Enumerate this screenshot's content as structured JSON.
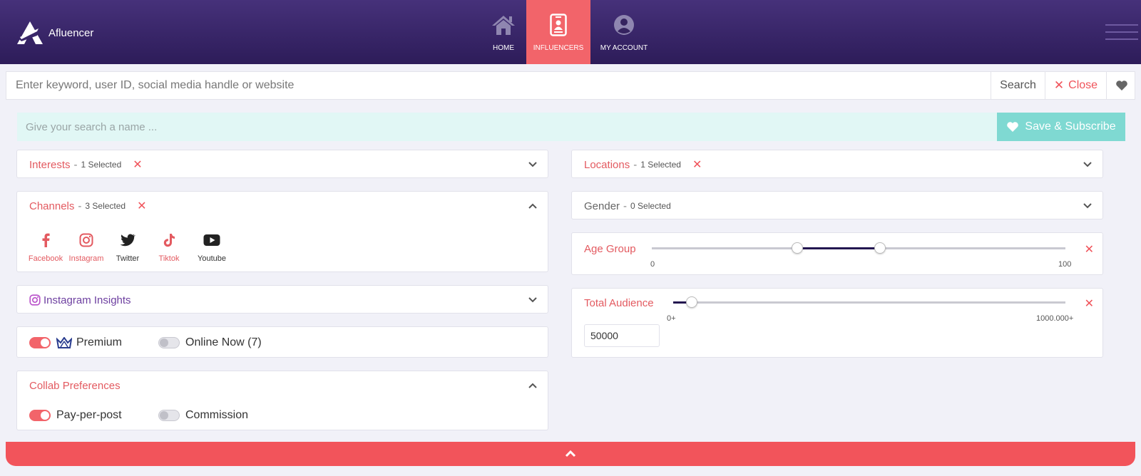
{
  "app": {
    "name": "Afluencer"
  },
  "nav": {
    "home": "HOME",
    "influencers": "INFLUENCERS",
    "account": "MY ACCOUNT"
  },
  "search": {
    "placeholder": "Enter keyword, user ID, social media handle or website",
    "search_label": "Search",
    "close_label": "Close"
  },
  "subscribe": {
    "placeholder": "Give your search a name ...",
    "button_label": "Save & Subscribe"
  },
  "filters": {
    "interests": {
      "title": "Interests",
      "count": "1 Selected"
    },
    "channels": {
      "title": "Channels",
      "count": "3 Selected",
      "items": [
        {
          "label": "Facebook",
          "icon": "facebook-icon"
        },
        {
          "label": "Instagram",
          "icon": "instagram-icon"
        },
        {
          "label": "Twitter",
          "icon": "twitter-icon"
        },
        {
          "label": "Tiktok",
          "icon": "tiktok-icon"
        },
        {
          "label": "Youtube",
          "icon": "youtube-icon"
        }
      ]
    },
    "instagram_insights": {
      "title": "Instagram Insights"
    },
    "premium": {
      "label": "Premium",
      "on": true
    },
    "online_now": {
      "label": "Online Now (7)",
      "on": false
    },
    "collab": {
      "title": "Collab Preferences",
      "pay_per_post": {
        "label": "Pay-per-post",
        "on": true
      },
      "commission": {
        "label": "Commission",
        "on": false
      }
    },
    "locations": {
      "title": "Locations",
      "count": "1 Selected"
    },
    "gender": {
      "title": "Gender",
      "count": "0 Selected"
    },
    "age_group": {
      "title": "Age Group",
      "min_label": "0",
      "max_label": "100",
      "range": [
        35,
        55
      ]
    },
    "total_audience": {
      "title": "Total Audience",
      "min_label": "0+",
      "max_label": "1000.000+",
      "value": "50000"
    }
  },
  "colors": {
    "nav_bg": "#3a2769",
    "accent": "#f2646a",
    "teal": "#7fd9d2",
    "slider_fill": "#231650"
  }
}
